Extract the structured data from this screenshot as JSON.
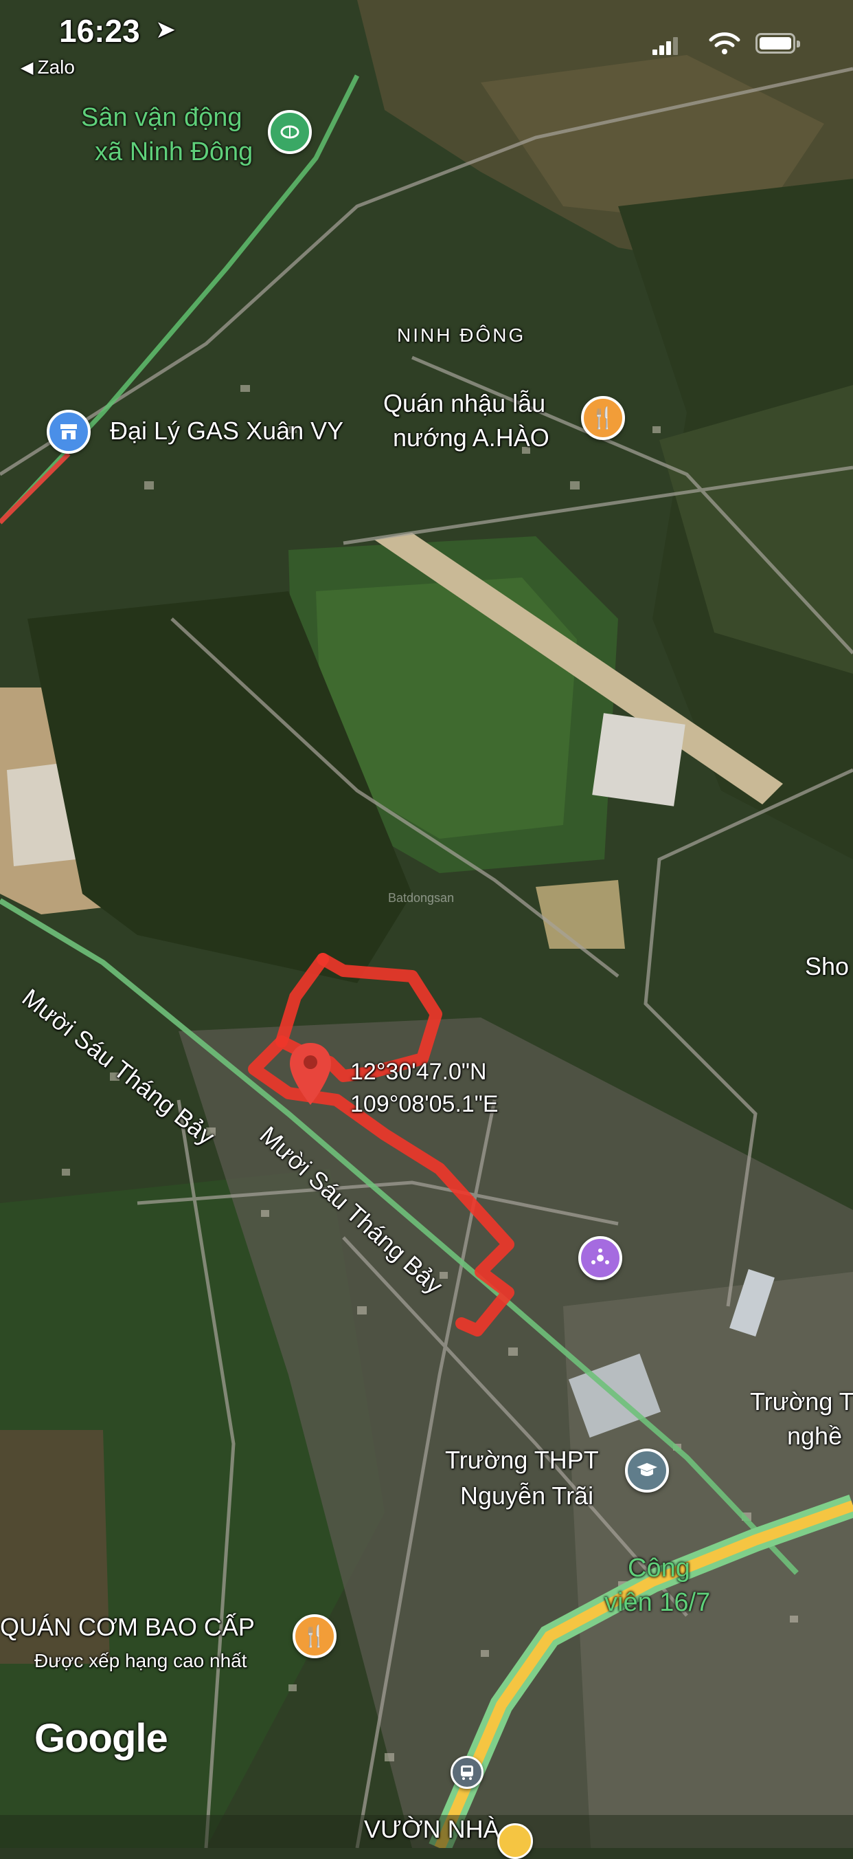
{
  "status_bar": {
    "time": "16:23",
    "back_app": "Zalo"
  },
  "map": {
    "attribution": "Google",
    "coordinates": {
      "lat": "12°30'47.0\"N",
      "lng": "109°08'05.1\"E"
    },
    "places": {
      "stadium_line1": "Sân vận động",
      "stadium_line2": "xã Ninh Đông",
      "ninh_dong": "NINH ĐÔNG",
      "gas": "Đại Lý GAS Xuân VY",
      "restaurant_line1": "Quán nhậu lẫu",
      "restaurant_line2": "nướng A.HÀO",
      "road_1": "Mười Sáu Tháng Bảy",
      "road_2": "Mười Sáu Tháng Bảy",
      "sho": "Sho",
      "school_right_line1": "Trường T",
      "school_right_line2": "nghề",
      "school_thpt_line1": "Trường THPT",
      "school_thpt_line2": "Nguyễn Trãi",
      "park_line1": "Công",
      "park_line2": "viên 16/7",
      "quan_com": "QUÁN CƠM BAO CẤP",
      "quan_com_sub": "Được xếp hạng cao nhất",
      "vuon_nha": "VƯỜN NHÀ"
    },
    "watermark": "Batdongsan",
    "colors": {
      "pin": "#e8453c",
      "boundary": "#f0362a",
      "restaurant_poi": "#f29d38",
      "gas_poi": "#4a8fe8",
      "stadium_poi": "#3aa865",
      "school_poi": "#607d8b",
      "attraction_poi": "#a56be0",
      "major_road": "#7fcf8a",
      "highway": "#f5c542",
      "label_green": "#5fd07a"
    }
  }
}
